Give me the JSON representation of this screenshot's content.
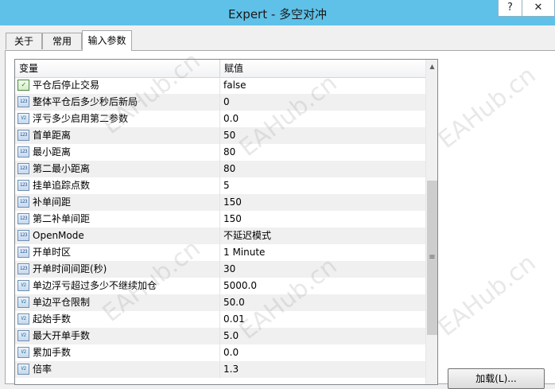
{
  "window": {
    "title": "Expert - 多空对冲",
    "help_label": "?",
    "close_label": "✕"
  },
  "tabs": [
    {
      "label": "关于",
      "active": false
    },
    {
      "label": "常用",
      "active": false
    },
    {
      "label": "输入参数",
      "active": true
    }
  ],
  "grid": {
    "headers": {
      "variable": "变量",
      "value": "赋值"
    },
    "rows": [
      {
        "type": "bool",
        "name": "平仓后停止交易",
        "value": "false"
      },
      {
        "type": "int",
        "name": "整体平仓后多少秒后新局",
        "value": "0"
      },
      {
        "type": "double",
        "name": "浮亏多少启用第二参数",
        "value": "0.0"
      },
      {
        "type": "int",
        "name": "首单距离",
        "value": "50"
      },
      {
        "type": "int",
        "name": "最小距离",
        "value": "80"
      },
      {
        "type": "int",
        "name": "第二最小距离",
        "value": "80"
      },
      {
        "type": "int",
        "name": "挂单追踪点数",
        "value": "5"
      },
      {
        "type": "int",
        "name": "补单间距",
        "value": "150"
      },
      {
        "type": "int",
        "name": "第二补单间距",
        "value": "150"
      },
      {
        "type": "int",
        "name": "OpenMode",
        "value": "不延迟模式"
      },
      {
        "type": "int",
        "name": "开单时区",
        "value": "1 Minute"
      },
      {
        "type": "int",
        "name": "开单时间间距(秒)",
        "value": "30"
      },
      {
        "type": "double",
        "name": "单边浮亏超过多少不继续加仓",
        "value": "5000.0"
      },
      {
        "type": "double",
        "name": "单边平仓限制",
        "value": "50.0"
      },
      {
        "type": "double",
        "name": "起始手数",
        "value": "0.01"
      },
      {
        "type": "double",
        "name": "最大开单手数",
        "value": "5.0"
      },
      {
        "type": "double",
        "name": "累加手数",
        "value": "0.0"
      },
      {
        "type": "double",
        "name": "倍率",
        "value": "1.3"
      }
    ]
  },
  "scrollbar": {
    "up_arrow": "▲",
    "grip": "≡"
  },
  "buttons": {
    "load_label": "加载(L)..."
  },
  "watermark": "EAHub.cn",
  "icons": {
    "bool": "bool-icon",
    "int": "integer-type-icon",
    "double": "double-type-icon"
  },
  "colors": {
    "titlebar": "#5fc1e8",
    "row_alt": "#f0f0f0",
    "watermark": "#969696"
  }
}
